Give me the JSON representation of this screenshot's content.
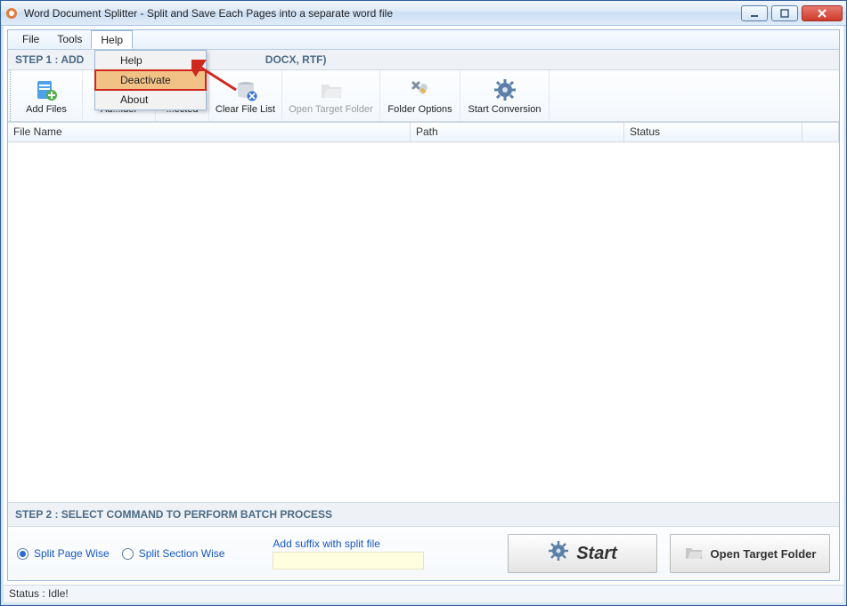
{
  "titlebar": {
    "title": "Word Document Splitter - Split and Save Each Pages into a separate word file"
  },
  "menubar": {
    "file": "File",
    "tools": "Tools",
    "help": "Help"
  },
  "help_menu": {
    "help": "Help",
    "deactivate": "Deactivate",
    "about": "About"
  },
  "step1": {
    "label_prefix": "STEP 1 : ADD",
    "label_suffix": " DOCX, RTF)"
  },
  "toolbar": {
    "add_files": "Add Files",
    "add_folder": "Ad...lder",
    "remove_selected": "...ected",
    "clear_list": "Clear File List",
    "open_target": "Open Target Folder",
    "folder_options": "Folder Options",
    "start_conv": "Start Conversion"
  },
  "table": {
    "h1": "File Name",
    "h2": "Path",
    "h3": "Status"
  },
  "step2": {
    "label": "STEP 2 : SELECT COMMAND TO PERFORM BATCH PROCESS"
  },
  "options": {
    "page_wise": "Split Page Wise",
    "section_wise": "Split Section Wise",
    "suffix_label": "Add suffix with split file"
  },
  "buttons": {
    "start": "Start",
    "open_target": "Open Target Folder"
  },
  "statusbar": {
    "text": "Status  :  Idle!"
  }
}
